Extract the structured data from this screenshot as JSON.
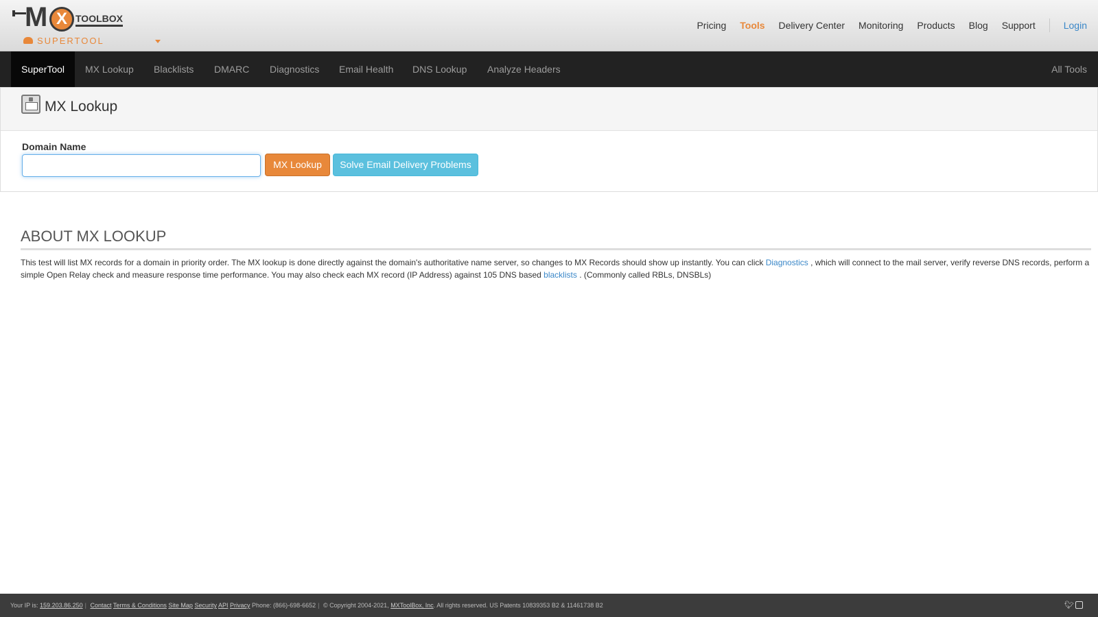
{
  "brand": {
    "logo_m": "M",
    "logo_x": "X",
    "logo_toolbox": "TOOLBOX",
    "supertool": "SUPERTOOL"
  },
  "topnav": {
    "items": [
      "Pricing",
      "Tools",
      "Delivery Center",
      "Monitoring",
      "Products",
      "Blog",
      "Support"
    ],
    "active": "Tools",
    "login": "Login"
  },
  "toolbar": {
    "tabs": [
      "SuperTool",
      "MX Lookup",
      "Blacklists",
      "DMARC",
      "Diagnostics",
      "Email Health",
      "DNS Lookup",
      "Analyze Headers"
    ],
    "all_tools": "All Tools"
  },
  "panel": {
    "title": "MX Lookup",
    "domain_label": "Domain Name",
    "domain_value": "",
    "lookup_button": "MX Lookup",
    "solve_button": "Solve Email Delivery Problems"
  },
  "about": {
    "title": "ABOUT MX LOOKUP",
    "text_1": "This test will list MX records for a domain in priority order. The MX lookup is done directly against the domain's authoritative name server, so changes to MX Records should show up instantly. You can click ",
    "link_diagnostics": "Diagnostics",
    "text_2": " , which will connect to the mail server, verify reverse DNS records, perform a simple Open Relay check and measure response time performance. You may also check each MX record (IP Address) against 105 DNS based ",
    "link_blacklists": "blacklists",
    "text_3": " . (Commonly called RBLs, DNSBLs)"
  },
  "footer": {
    "ip_label": "Your IP is:",
    "ip": "159.203.86.250",
    "links": [
      "Contact",
      "Terms & Conditions",
      "Site Map",
      "Security",
      "API",
      "Privacy"
    ],
    "phone": "Phone: (866)-698-6652",
    "copyright": "© Copyright 2004-2021,",
    "company": "MXToolBox, Inc",
    "rights": ". All rights reserved. US Patents 10839353 B2 & 11461738 B2"
  },
  "colors": {
    "accent": "#e8883a",
    "info": "#5bc0de",
    "link": "#3a87c8",
    "navbar": "#222222"
  }
}
